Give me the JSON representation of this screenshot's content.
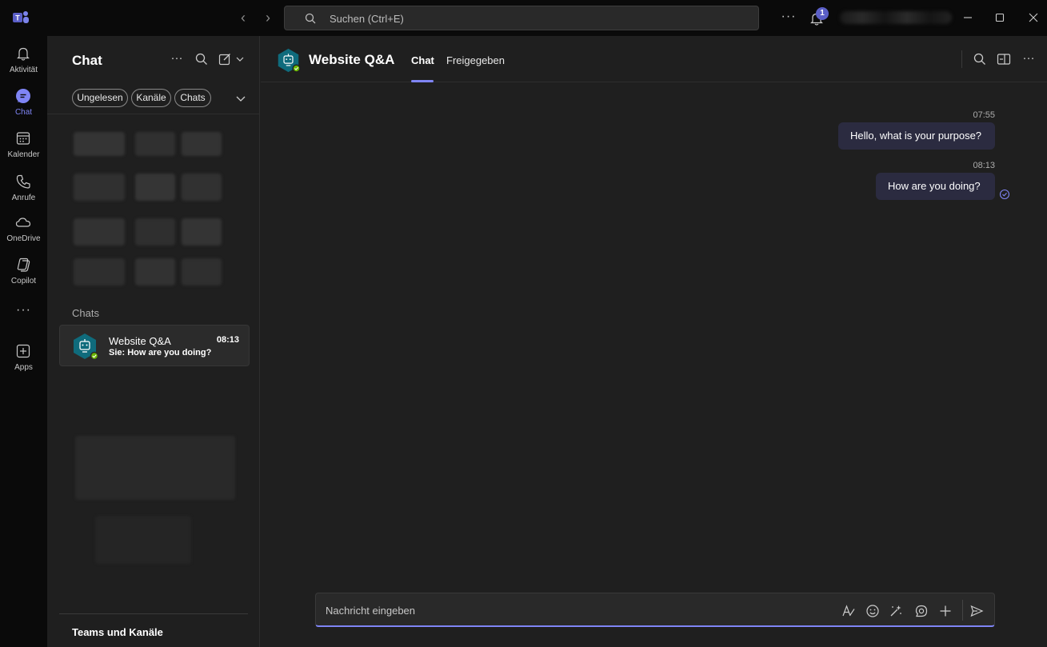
{
  "titlebar": {
    "search_placeholder": "Suchen (Ctrl+E)",
    "notification_count": "1",
    "more_label": "···"
  },
  "rail": {
    "items": [
      {
        "label": "Aktivität",
        "icon": "bell-icon"
      },
      {
        "label": "Chat",
        "icon": "chat-icon"
      },
      {
        "label": "Kalender",
        "icon": "calendar-icon"
      },
      {
        "label": "Anrufe",
        "icon": "phone-icon"
      },
      {
        "label": "OneDrive",
        "icon": "cloud-icon"
      },
      {
        "label": "Copilot",
        "icon": "copilot-icon"
      },
      {
        "label": "Apps",
        "icon": "apps-plus-icon"
      }
    ],
    "more_label": "···"
  },
  "list": {
    "title": "Chat",
    "more_label": "···",
    "filters": [
      "Ungelesen",
      "Kanäle",
      "Chats"
    ],
    "section_chats": "Chats",
    "chat_item": {
      "name": "Website Q&A",
      "time": "08:13",
      "preview": "Sie: How are you doing?"
    },
    "teams_section": "Teams und Kanäle"
  },
  "main": {
    "title": "Website Q&A",
    "tabs": [
      "Chat",
      "Freigegeben"
    ],
    "more_label": "···",
    "messages": [
      {
        "time": "07:55",
        "text": "Hello, what is your purpose?"
      },
      {
        "time": "08:13",
        "text": "How are you doing?"
      }
    ],
    "composer_placeholder": "Nachricht eingeben"
  },
  "colors": {
    "accent": "#7f85f5",
    "bubble": "#2b2b40",
    "bot_avatar": "#0f6b7c",
    "presence": "#6bb700",
    "badge": "#5b5fc7"
  }
}
